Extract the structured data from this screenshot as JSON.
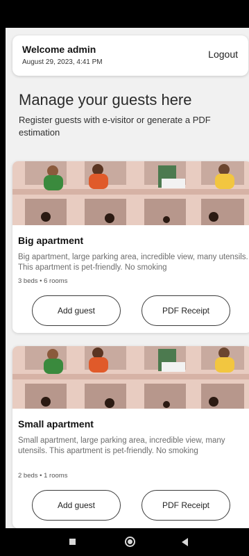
{
  "header": {
    "welcome": "Welcome admin",
    "datetime": "August 29, 2023, 4:41 PM",
    "logout_label": "Logout"
  },
  "page": {
    "title": "Manage your guests here",
    "subtitle": "Register guests with e-visitor or generate a PDF estimation"
  },
  "apartments": [
    {
      "title": "Big apartment",
      "description": "Big apartment, large parking area, incredible view, many utensils. This apartment is pet-friendly. No smoking",
      "meta": "3 beds • 6 rooms",
      "add_guest_label": "Add guest",
      "pdf_label": "PDF Receipt"
    },
    {
      "title": "Small apartment",
      "description": "Small apartment, large parking area, incredible view, many utensils. This apartment is pet-friendly. No smoking",
      "meta": "2 beds • 1 rooms",
      "add_guest_label": "Add guest",
      "pdf_label": "PDF Receipt"
    }
  ],
  "colors": {
    "background": "#f1f1f1",
    "card": "#ffffff",
    "illustration_bg": "#e8ccc1",
    "illustration_window": "#b7978c"
  },
  "icons": {
    "nav_recents": "square-icon",
    "nav_home": "circle-icon",
    "nav_back": "triangle-back-icon"
  }
}
